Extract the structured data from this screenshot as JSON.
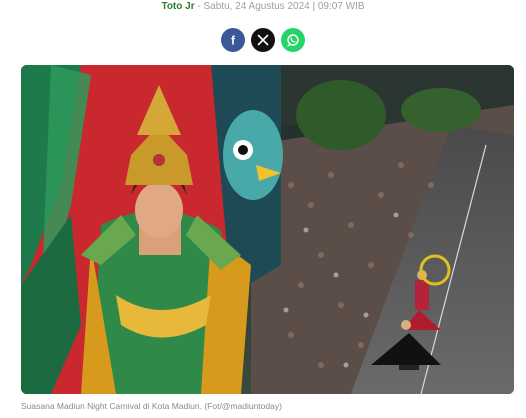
{
  "byline": {
    "author": "Toto Jr",
    "separator": " - ",
    "datetime": "Sabtu, 24 Agustus 2024 | 09:07 WIB"
  },
  "share": [
    {
      "name": "facebook-icon",
      "glyph": "f",
      "color": "#3b5998"
    },
    {
      "name": "x-icon",
      "glyph": "𝕏",
      "color": "#111111"
    },
    {
      "name": "whatsapp-icon",
      "glyph": "",
      "color": "#25d366"
    }
  ],
  "photo": {
    "caption": "Suasana Madiun Night Carnival di Kota Madiun. (Fot/@madiuntoday)"
  }
}
